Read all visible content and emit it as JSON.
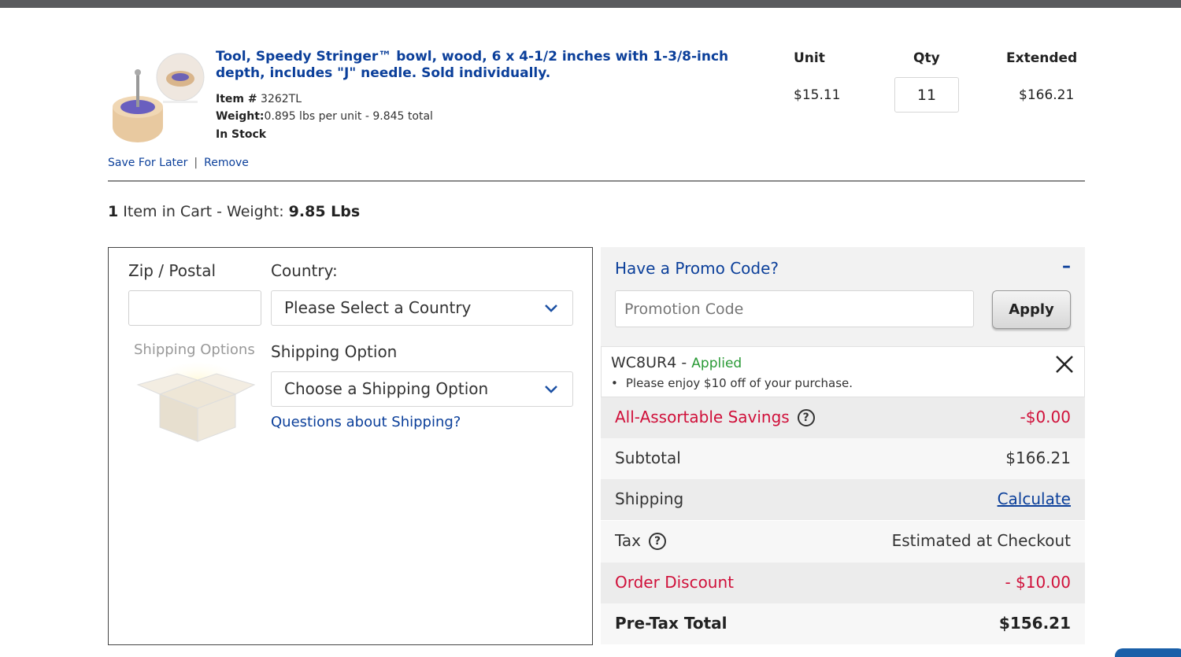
{
  "product": {
    "title": "Tool, Speedy Stringer™ bowl, wood, 6 x 4-1/2 inches with 1-3/8-inch depth, includes \"J\" needle. Sold individually.",
    "item_label": "Item #",
    "item_number": "3262TL",
    "weight_label": "Weight:",
    "weight_value": "0.895 lbs per unit - 9.845 total",
    "stock": "In Stock",
    "save_for_later": "Save For Later",
    "separator": "|",
    "remove": "Remove",
    "image_icon": "product-photo"
  },
  "columns": {
    "unit": "Unit",
    "qty": "Qty",
    "extended": "Extended"
  },
  "line": {
    "unit_price": "$15.11",
    "qty": "11",
    "extended_price": "$166.21"
  },
  "cart_summary": {
    "count": "1",
    "text": " Item in Cart - Weight: ",
    "weight": "9.85 Lbs"
  },
  "shipping": {
    "zip_label": "Zip / Postal",
    "zip_value": "",
    "country_label": "Country:",
    "country_selected": "Please Select a Country",
    "option_label": "Shipping Option",
    "option_selected": "Choose a Shipping Option",
    "help_link": "Questions about Shipping?",
    "illustration_text": "Shipping Options"
  },
  "promo": {
    "title": "Have a Promo Code?",
    "toggle": "–",
    "placeholder": "Promotion Code",
    "apply": "Apply",
    "applied_code": "WC8UR4",
    "applied_dash": " - ",
    "applied_status": "Applied",
    "applied_note": "Please enjoy $10 off of your purchase."
  },
  "summary": {
    "savings_label": "All-Assortable Savings",
    "savings_value": "-$0.00",
    "subtotal_label": "Subtotal",
    "subtotal_value": "$166.21",
    "shipping_label": "Shipping",
    "shipping_value": "Calculate",
    "tax_label": "Tax",
    "tax_value": "Estimated at Checkout",
    "discount_label": "Order Discount",
    "discount_value": "- $10.00",
    "pretax_label": "Pre-Tax Total",
    "pretax_value": "$156.21",
    "help_glyph": "?"
  },
  "colors": {
    "link_blue": "#0b3f9a",
    "savings_red": "#d0103a",
    "applied_green": "#2a9a36",
    "topbar": "#5a5b5e"
  }
}
